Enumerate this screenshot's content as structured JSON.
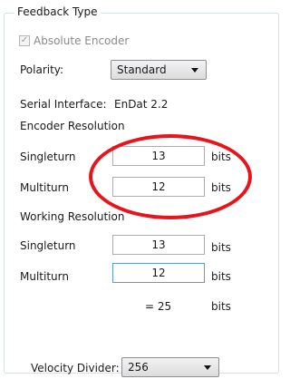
{
  "group_title": "Feedback Type",
  "absolute_encoder": {
    "label": "Absolute Encoder",
    "checked": true,
    "check_glyph": "✓"
  },
  "polarity": {
    "label": "Polarity:",
    "value": "Standard"
  },
  "serial_interface": {
    "label": "Serial Interface:",
    "value": "EnDat 2.2"
  },
  "encoder_resolution": {
    "heading": "Encoder Resolution",
    "singleturn": {
      "label": "Singleturn",
      "value": "13",
      "unit": "bits"
    },
    "multiturn": {
      "label": "Multiturn",
      "value": "12",
      "unit": "bits"
    }
  },
  "working_resolution": {
    "heading": "Working Resolution",
    "singleturn": {
      "label": "Singleturn",
      "value": "13",
      "unit": "bits"
    },
    "multiturn": {
      "label": "Multiturn",
      "value": "12",
      "unit": "bits"
    },
    "total": {
      "value": "= 25",
      "unit": "bits"
    }
  },
  "velocity_divider": {
    "label": "Velocity Divider:",
    "value": "256"
  },
  "annotation_color": "#e8141b"
}
